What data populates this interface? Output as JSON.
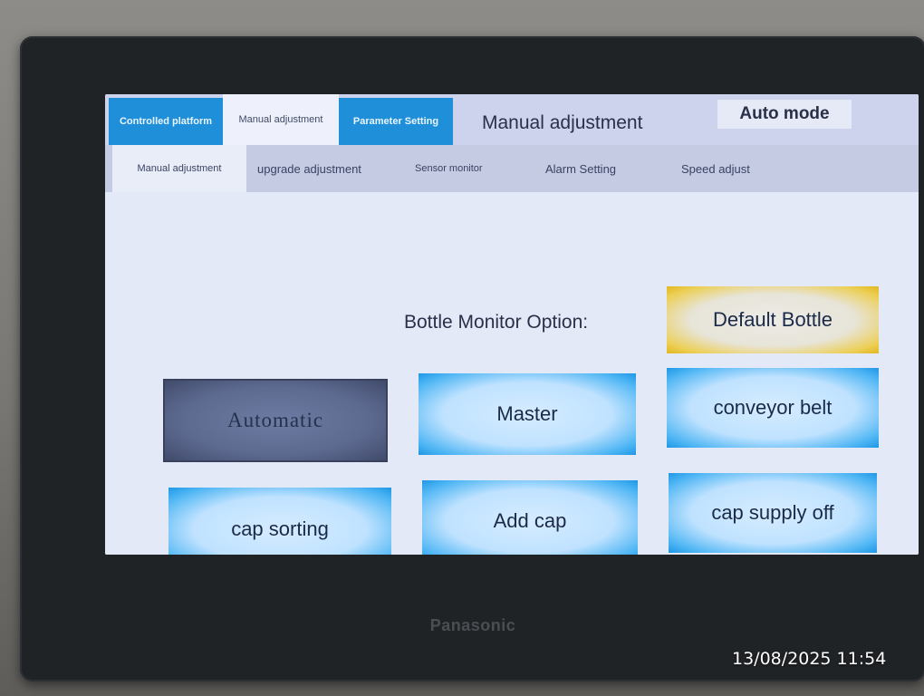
{
  "device": {
    "brand": "Panasonic"
  },
  "tabs": [
    {
      "label": "Controlled platform",
      "state": "inactive"
    },
    {
      "label": "Manual adjustment",
      "state": "active"
    },
    {
      "label": "Parameter Setting",
      "state": "inactive"
    }
  ],
  "header": {
    "title": "Manual adjustment",
    "mode": "Auto mode"
  },
  "subtabs": [
    {
      "label": "Manual adjustment",
      "state": "active"
    },
    {
      "label": "upgrade adjustment"
    },
    {
      "label": "Sensor monitor"
    },
    {
      "label": "Alarm Setting"
    },
    {
      "label": "Speed adjust"
    }
  ],
  "main": {
    "bottle_option_label": "Bottle Monitor Option:",
    "bottle_option_value": "Default Bottle",
    "buttons": [
      {
        "label": "Automatic",
        "state": "pressed"
      },
      {
        "label": "Master"
      },
      {
        "label": "conveyor belt"
      },
      {
        "label": "cap sorting"
      },
      {
        "label": "Add cap"
      },
      {
        "label": "cap supply off"
      }
    ]
  },
  "photo": {
    "timestamp": "13/08/2025 11:54"
  },
  "colors": {
    "tab_blue": "#1e8fd8",
    "button_blue": "#1f97e6",
    "button_gold": "#e3b61e",
    "button_pressed": "#4a557a"
  }
}
